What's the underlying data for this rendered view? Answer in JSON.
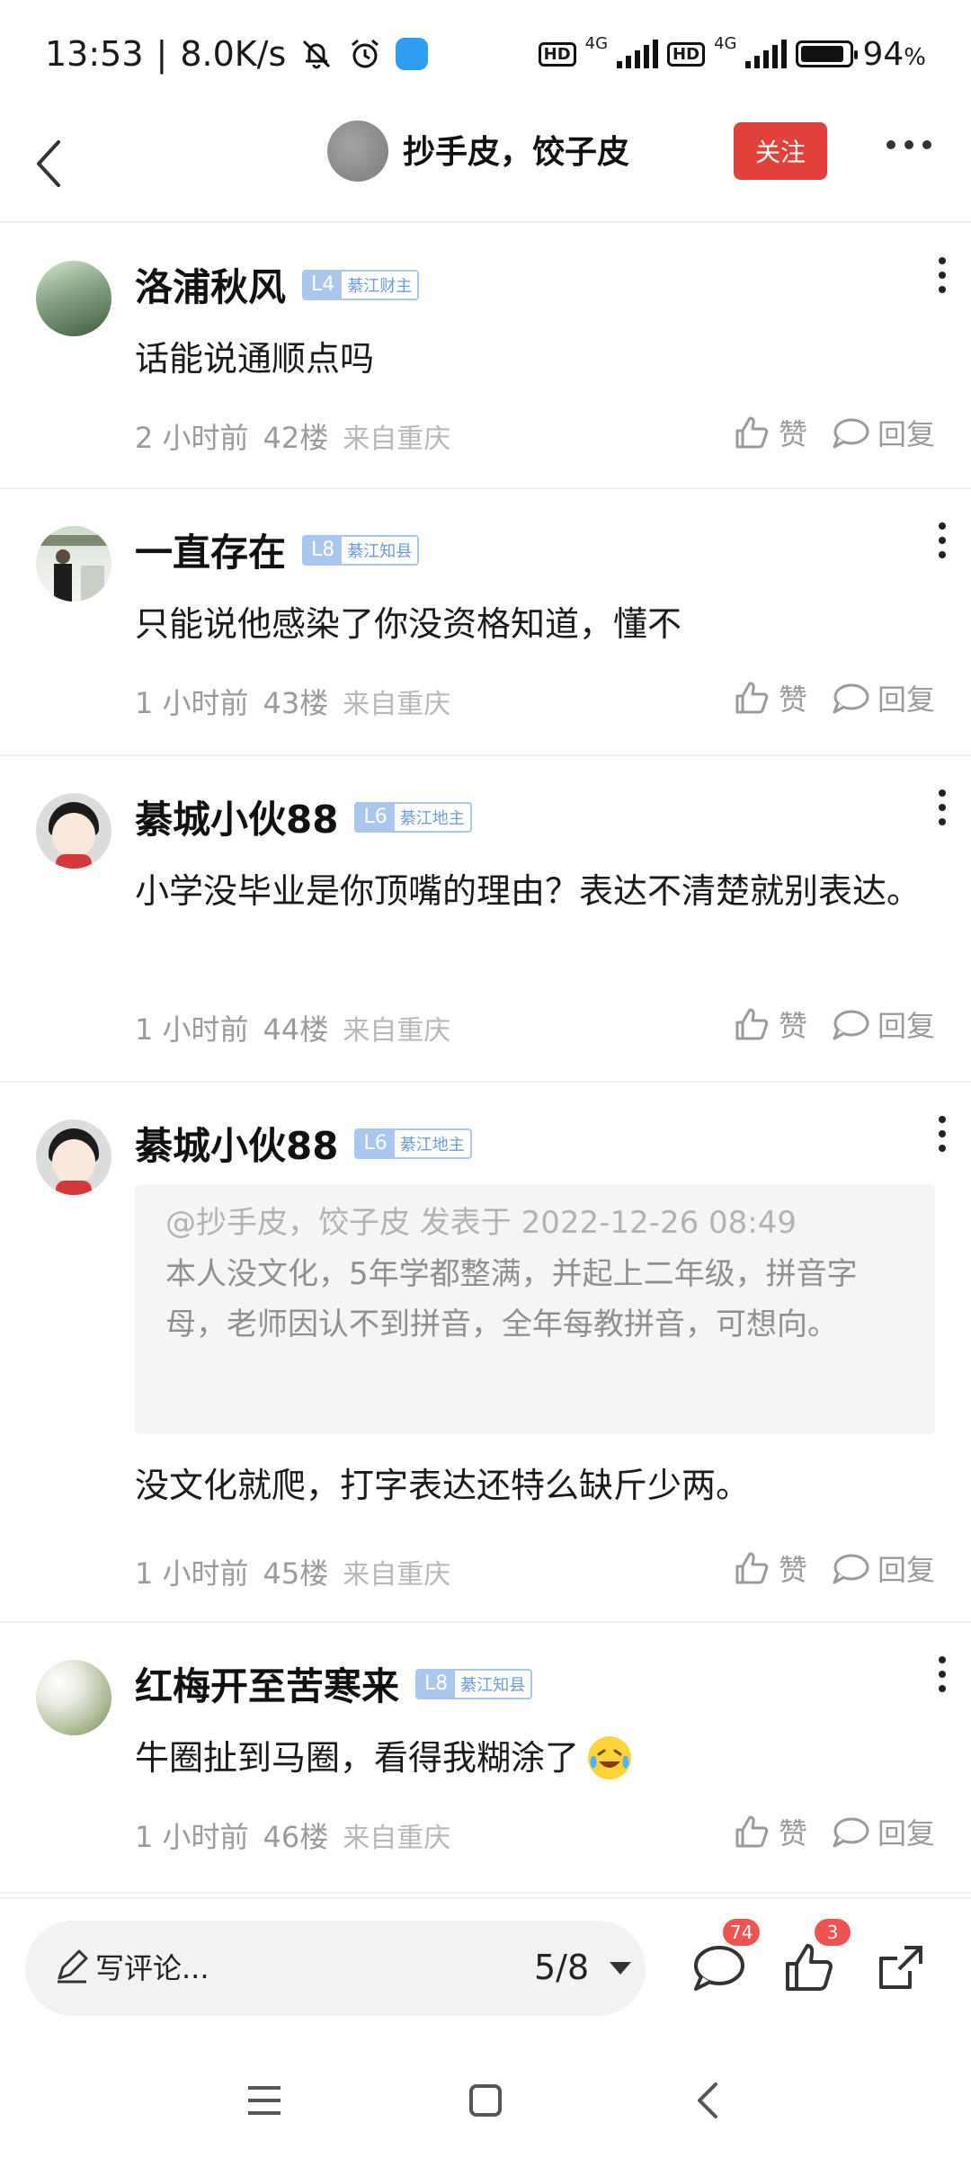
{
  "status_bar": {
    "time": "13:53",
    "separator": "|",
    "speed": "8.0K/s",
    "hd1": "HD",
    "net1": "4G",
    "hd2": "HD",
    "net2": "4G",
    "battery": "94",
    "battery_unit": "%"
  },
  "header": {
    "title": "抄手皮，饺子皮",
    "follow_label": "关注"
  },
  "comments": [
    {
      "name": "洛浦秋风",
      "level": "L4",
      "level_title": "綦江财主",
      "text": "话能说通顺点吗",
      "time": "2 小时前",
      "floor": "42楼",
      "location": "来自重庆",
      "like_label": "赞",
      "reply_label": "回复"
    },
    {
      "name": "一直存在",
      "level": "L8",
      "level_title": "綦江知县",
      "text": "只能说他感染了你没资格知道，懂不",
      "time": "1 小时前",
      "floor": "43楼",
      "location": "来自重庆",
      "like_label": "赞",
      "reply_label": "回复"
    },
    {
      "name": "綦城小伙88",
      "level": "L6",
      "level_title": "綦江地主",
      "text": "小学没毕业是你顶嘴的理由？表达不清楚就别表达。",
      "time": "1 小时前",
      "floor": "44楼",
      "location": "来自重庆",
      "like_label": "赞",
      "reply_label": "回复"
    },
    {
      "name": "綦城小伙88",
      "level": "L6",
      "level_title": "綦江地主",
      "quote_head": "@抄手皮，饺子皮 发表于 2022-12-26 08:49",
      "quote_text": "本人没文化，5年学都整满，并起上二年级，拼音字母，老师因认不到拼音，全年每教拼音，可想向。",
      "text": "没文化就爬，打字表达还特么缺斤少两。",
      "time": "1 小时前",
      "floor": "45楼",
      "location": "来自重庆",
      "like_label": "赞",
      "reply_label": "回复"
    },
    {
      "name": "红梅开至苦寒来",
      "level": "L8",
      "level_title": "綦江知县",
      "text": "牛圈扯到马圈，看得我糊涂了",
      "time": "1 小时前",
      "floor": "46楼",
      "location": "来自重庆",
      "like_label": "赞",
      "reply_label": "回复"
    }
  ],
  "bottom_bar": {
    "write_placeholder": "写评论...",
    "page_indicator": "5/8",
    "comment_count": "74",
    "like_count": "3"
  },
  "colors": {
    "accent_red": "#e0413a",
    "badge_red": "#ef5350",
    "level_blue": "#a9c7ee"
  }
}
